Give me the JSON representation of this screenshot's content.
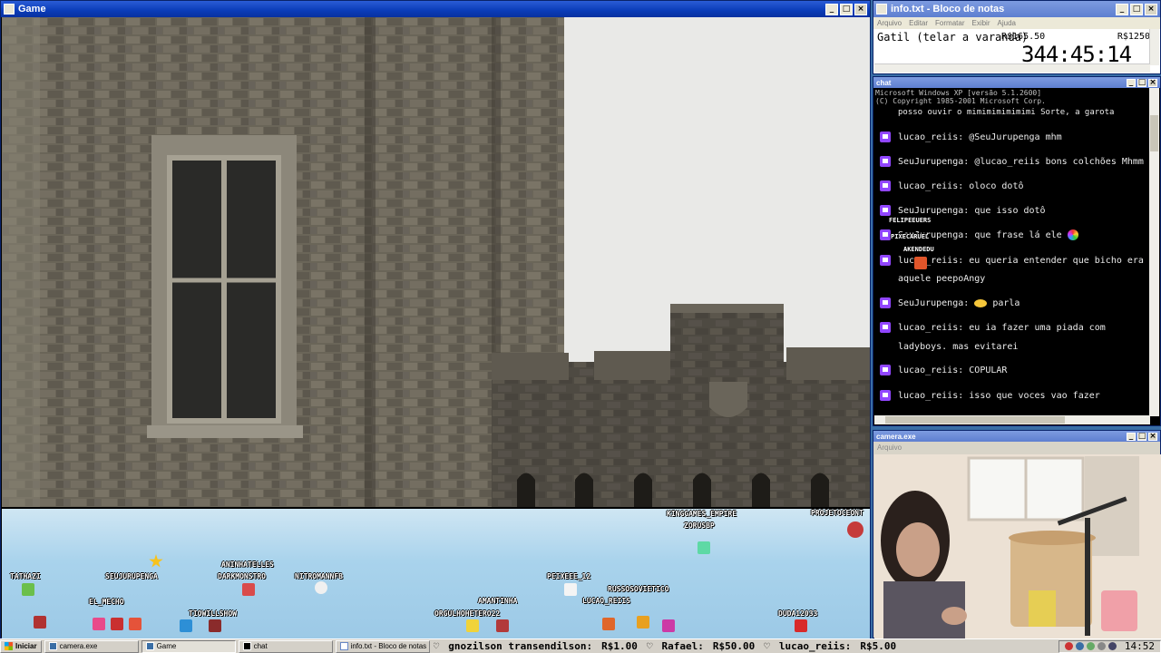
{
  "game": {
    "title": "Game",
    "players": [
      {
        "name": "TATHAZI"
      },
      {
        "name": "SEUJURUPENGA"
      },
      {
        "name": "ANINHATELLES"
      },
      {
        "name": "DARKMONSTRO"
      },
      {
        "name": "NITROMANNFB"
      },
      {
        "name": "EL_MECHO"
      },
      {
        "name": "TIOWILLSHOW"
      },
      {
        "name": "KINGGAMES_EMPIRE"
      },
      {
        "name": "ZORUSBP"
      },
      {
        "name": "PROJETOCEONT"
      },
      {
        "name": "PEIXEEE_12"
      },
      {
        "name": "RUSSOSOVIETICO"
      },
      {
        "name": "AMANTINHA"
      },
      {
        "name": "LUCAO_REIIS"
      },
      {
        "name": "ORGULHOHETERO22"
      },
      {
        "name": "DUDA12033"
      }
    ]
  },
  "notepad": {
    "title": "info.txt - Bloco de notas",
    "menu": [
      "Arquivo",
      "Editar",
      "Formatar",
      "Exibir",
      "Ajuda"
    ],
    "item": "Gatil (telar a varanda)",
    "current": "R$165.50",
    "goal": "R$1250",
    "timer": "344:45:14"
  },
  "chat": {
    "title": "chat",
    "header1": "Microsoft Windows XP [versão 5.1.2600]",
    "header2": "(C) Copyright 1985-2001 Microsoft Corp.",
    "partial": "posso ouvir o mimimimimimimi  Sorte, a garota",
    "messages": [
      {
        "user": "lucao_reiis:",
        "text": "@SeuJurupenga mhm"
      },
      {
        "user": "SeuJurupenga:",
        "text": "@lucao_reiis bons colchões Mhmm"
      },
      {
        "user": "lucao_reiis:",
        "text": "oloco dotô"
      },
      {
        "user": "SeuJurupenga:",
        "text": "que isso dotô"
      },
      {
        "user": "SeuJurupenga:",
        "text": "que frase lá ele"
      },
      {
        "user": "lucao_reiis:",
        "text": "eu queria entender que bicho era",
        "cont": "aquele peepoAngy"
      },
      {
        "user": "SeuJurupenga:",
        "text": "parla"
      },
      {
        "user": "lucao_reiis:",
        "text": "eu ia fazer uma piada com",
        "cont": "ladyboys. mas evitarei"
      },
      {
        "user": "lucao_reiis:",
        "text": "COPULAR"
      },
      {
        "user": "lucao_reiis:",
        "text": "isso que voces vao fazer"
      }
    ],
    "overlay_names": [
      "FELIPEEUERS",
      "PIXECARUEL",
      "AKENDEDU"
    ]
  },
  "camera": {
    "title": "camera.exe",
    "subtitle": "Arquivo"
  },
  "taskbar": {
    "start": "Iniciar",
    "tasks": [
      "camera.exe",
      "Game",
      "chat",
      "info.txt - Bloco de notas"
    ],
    "ticker": [
      {
        "user": "gnozilson transendilson:",
        "amount": "R$1.00"
      },
      {
        "user": "Rafael:",
        "amount": "R$50.00"
      },
      {
        "user": "lucao_reiis:",
        "amount": "R$5.00"
      }
    ],
    "clock": "14:52"
  },
  "colors": {
    "twitch": "#9146ff",
    "titlebar": "#0a3cb8",
    "desktop": "#3a6ea5"
  }
}
